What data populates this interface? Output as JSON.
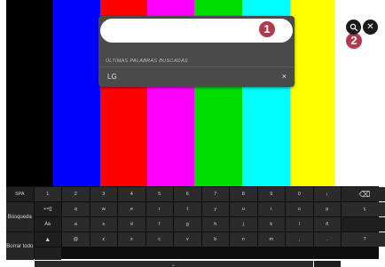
{
  "colors": {
    "bars": [
      "#000000",
      "#0000ff",
      "#ff0000",
      "#ff00ff",
      "#00dd00",
      "#00ffff",
      "#ffff00"
    ],
    "callout": "#b23a50",
    "panel": "#4a4a4a",
    "keyboard": "#0e0e0e"
  },
  "search": {
    "value": "",
    "recent_title": "ÚLTIMAS PALABRAS BUSCADAS",
    "recent_items": [
      {
        "text": "LG",
        "delete": "×"
      }
    ]
  },
  "callouts": {
    "one": "1",
    "two": "2"
  },
  "topbar": {
    "icon_left": "search-settings-icon",
    "icon_right": "close-icon",
    "close_glyph": "✕"
  },
  "keyboard": {
    "rows": [
      [
        "SPA",
        "1",
        "2",
        "3",
        "4",
        "5",
        "6",
        "7",
        "8",
        "9",
        "0",
        "¡"
      ],
      [
        "+=[]",
        "q",
        "w",
        "e",
        "r",
        "t",
        "y",
        "u",
        "i",
        "o",
        "p",
        "ç"
      ],
      [
        "Àà",
        "a",
        "s",
        "d",
        "f",
        "g",
        "h",
        "j",
        "k",
        "l",
        "ñ",
        ""
      ],
      [
        "▲",
        "@",
        "z",
        "x",
        "c",
        "v",
        "b",
        "n",
        "m",
        ",",
        ".",
        "?"
      ]
    ],
    "right_keys": {
      "backspace": "⌫",
      "search": "Búsqueda",
      "clear": "Borrar todo"
    },
    "space": "⎵"
  }
}
